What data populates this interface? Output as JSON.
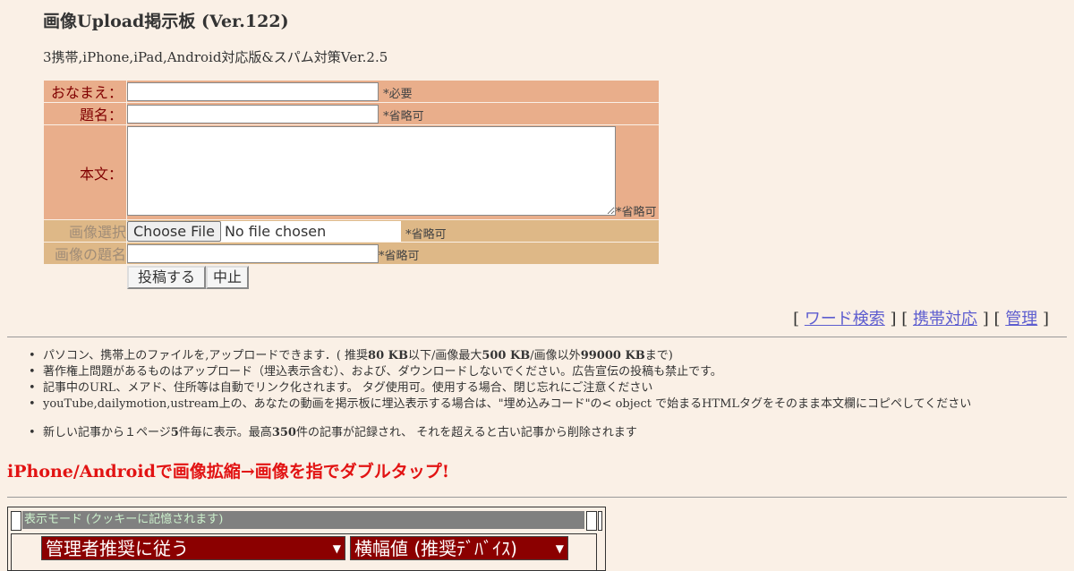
{
  "page": {
    "title": "画像Upload掲示板 (Ver.122)",
    "subtitle": "3携帯,iPhone,iPad,Android対応版&スパム対策Ver.2.5"
  },
  "form": {
    "name_label": "おなまえ：",
    "name_note": "*必要",
    "subject_label": "題名：",
    "subject_note": "*省略可",
    "body_label": "本文：",
    "body_note": "*省略可",
    "image_label": "画像選択",
    "file_button": "Choose File",
    "file_status": "No file chosen",
    "image_note": "*省略可",
    "image_title_label": "画像の題名",
    "image_title_note": "*省略可",
    "submit": "投稿する",
    "cancel": "中止"
  },
  "links": [
    {
      "label": "ワード検索"
    },
    {
      "label": "携帯対応"
    },
    {
      "label": "管理"
    }
  ],
  "info": {
    "line1_pre": "パソコン、携帯上のファイルを,アップロードできます．( 推奨",
    "line1_b1": "80 KB",
    "line1_mid": "以下/画像最大",
    "line1_b2": "500 KB",
    "line1_mid2": "/画像以外",
    "line1_b3": "99000 KB",
    "line1_post": "まで)",
    "line2": "著作権上問題があるものはアップロード（埋込表示含む）、および、ダウンロードしないでください。広告宣伝の投稿も禁止です。",
    "line3": "記事中のURL、メアド、住所等は自動でリンク化されます。 タグ使用可。使用する場合、閉じ忘れにご注意ください",
    "line4": "youTube,dailymotion,ustream上の、あなたの動画を掲示板に埋込表示する場合は、\"埋め込みコード\"の< object で始まるHTMLタグをそのまま本文欄にコピペしてください",
    "line5_pre": "新しい記事から１ページ",
    "line5_b1": "5",
    "line5_mid": "件毎に表示。最高",
    "line5_b2": "350",
    "line5_post": "件の記事が記録され、 それを超えると古い記事から削除されます"
  },
  "tap_notice": "iPhone/Androidで画像拡縮→画像を指でダブルタップ!",
  "mode": {
    "header": "表示モード (クッキーに記憶されます)",
    "select1": "管理者推奨に従う",
    "select2": "横幅値 (推奨ﾃﾞﾊﾞｲｽ)"
  },
  "colors": {
    "background": "#faf0e6",
    "form_label_bg": "#e9ae8b",
    "image_row_bg": "#deb887",
    "label_text": "#800000",
    "link": "#5d5dcf",
    "notice_red": "#e21313",
    "select_bg": "#8b0000"
  }
}
